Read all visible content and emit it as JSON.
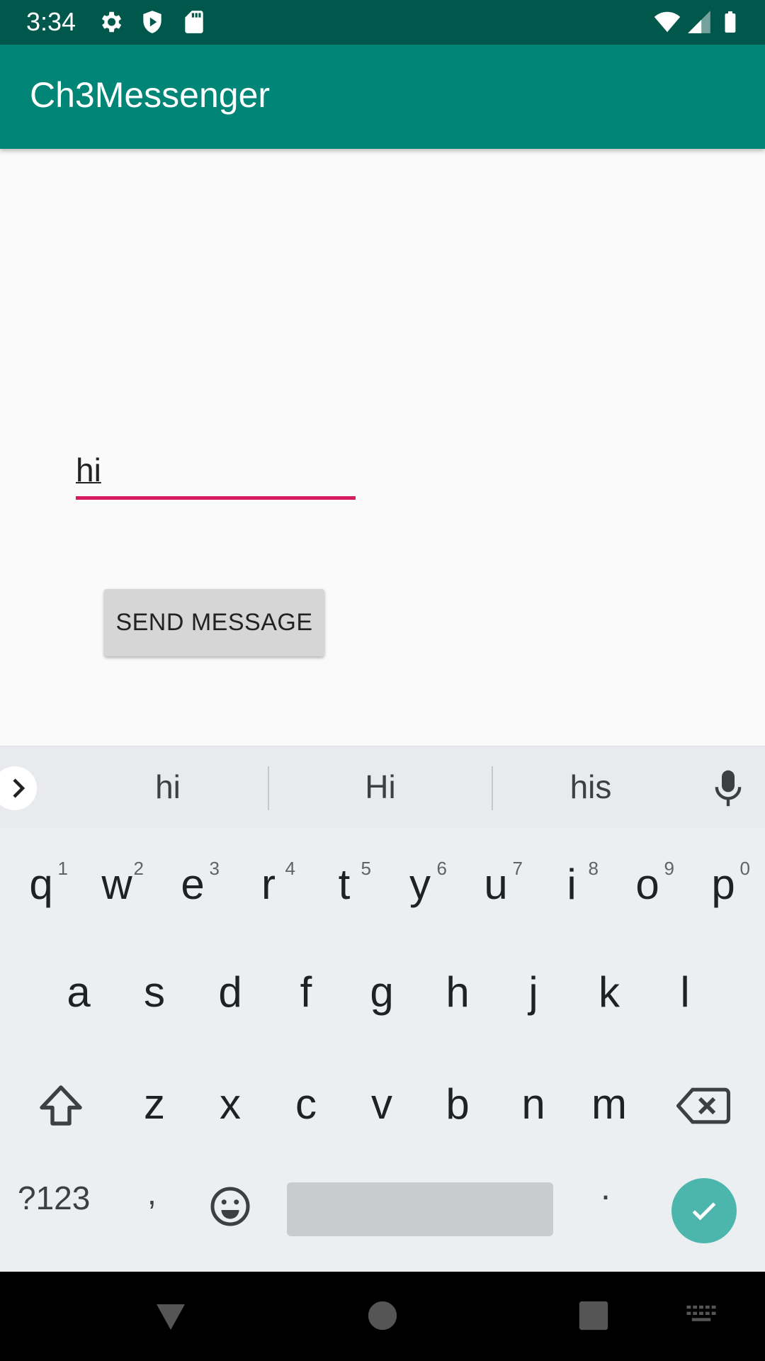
{
  "status_bar": {
    "time": "3:34",
    "icons": [
      "settings-icon",
      "shield-icon",
      "sd-card-icon",
      "wifi-icon",
      "cell-signal-icon",
      "battery-icon"
    ]
  },
  "app_bar": {
    "title": "Ch3Messenger"
  },
  "content": {
    "message_value": "hi",
    "send_label": "SEND MESSAGE"
  },
  "keyboard": {
    "suggestions": [
      "hi",
      "Hi",
      "his"
    ],
    "row1": [
      {
        "label": "q",
        "hint": "1"
      },
      {
        "label": "w",
        "hint": "2"
      },
      {
        "label": "e",
        "hint": "3"
      },
      {
        "label": "r",
        "hint": "4"
      },
      {
        "label": "t",
        "hint": "5"
      },
      {
        "label": "y",
        "hint": "6"
      },
      {
        "label": "u",
        "hint": "7"
      },
      {
        "label": "i",
        "hint": "8"
      },
      {
        "label": "o",
        "hint": "9"
      },
      {
        "label": "p",
        "hint": "0"
      }
    ],
    "row2": [
      "a",
      "s",
      "d",
      "f",
      "g",
      "h",
      "j",
      "k",
      "l"
    ],
    "row3": [
      "z",
      "x",
      "c",
      "v",
      "b",
      "n",
      "m"
    ],
    "symbols_label": "?123",
    "comma_label": ",",
    "period_label": "."
  },
  "colors": {
    "status_bar": "#00574b",
    "app_bar": "#008577",
    "accent": "#d81b60",
    "done_key": "#4db6ac"
  },
  "nav_bar": {
    "icons": [
      "back-icon",
      "home-icon",
      "recents-icon",
      "keyboard-switch-icon"
    ]
  }
}
